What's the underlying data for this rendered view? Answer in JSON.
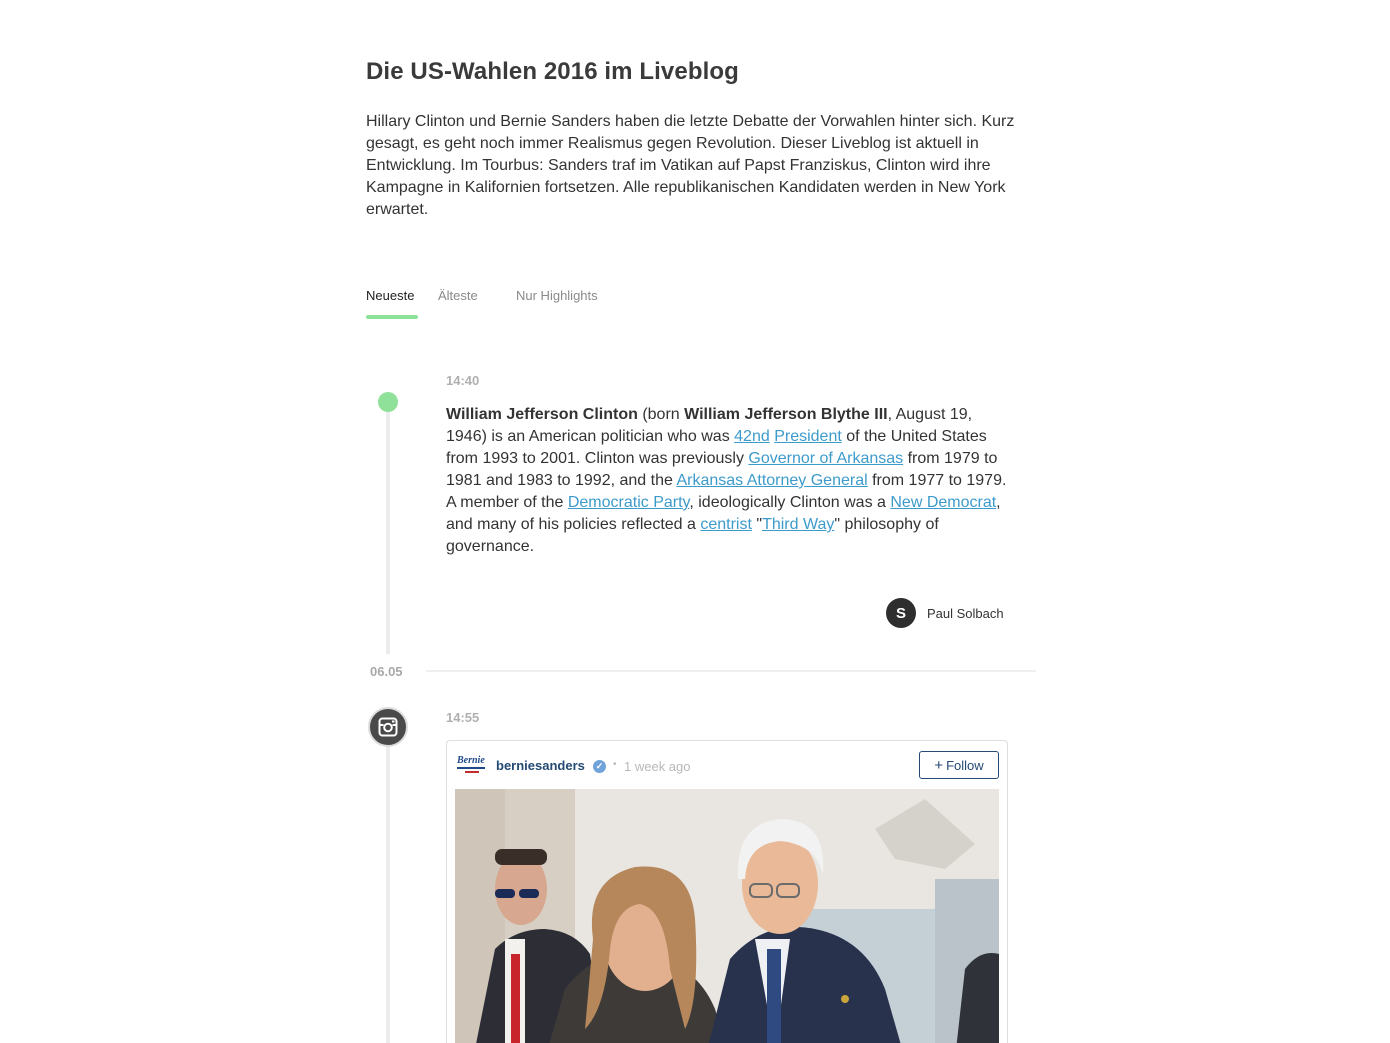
{
  "header": {
    "title": "Die US-Wahlen 2016 im Liveblog",
    "intro": "Hillary Clinton und Bernie Sanders haben die letzte Debatte der Vorwahlen hinter sich. Kurz gesagt, es geht noch immer Realismus gegen Revolution. Dieser Liveblog ist aktuell in Entwicklung. Im Tourbus: Sanders traf im Vatikan auf Papst Franziskus, Clinton wird ihre Kampagne in Kalifornien fortsetzen. Alle republikanischen Kandidaten werden in New York erwartet."
  },
  "tabs": [
    {
      "label": "Neueste",
      "active": true
    },
    {
      "label": "Älteste",
      "active": false
    },
    {
      "label": "Nur Highlights",
      "active": false
    }
  ],
  "posts": [
    {
      "time": "14:40",
      "body": {
        "t1": "William Jefferson Clinton",
        "t2": " (born ",
        "t3": "William Jefferson Blythe III",
        "t4": ", August 19, 1946) is an American politician who was ",
        "l1": "42nd",
        "t5": " ",
        "l2": "President",
        "t6": " of the United States from 1993 to 2001. Clinton was previously ",
        "l3": "Governor of Arkansas",
        "t7": " from 1979 to 1981 and 1983 to 1992, and the ",
        "l4": "Arkansas Attorney General",
        "t8": " from 1977 to 1979. A member of the ",
        "l5": "Democratic Party",
        "t9": ", ideologically Clinton was a ",
        "l6": "New Democrat",
        "t10": ", and many of his policies reflected a ",
        "l7": "centrist",
        "t11": " \"",
        "l8": "Third Way",
        "t12": "\" philosophy of governance."
      },
      "author": {
        "initial": "S",
        "name": "Paul Solbach"
      }
    },
    {
      "date_separator": "06.05",
      "time": "14:55",
      "embed": {
        "source_icon": "instagram-icon",
        "profile_logo_text": "Bernie",
        "username": "berniesanders",
        "separator": "•",
        "posted_ago": "1 week ago",
        "follow_plus": "+",
        "follow_label": "Follow"
      }
    }
  ],
  "colors": {
    "accent_green": "#8fe19a",
    "link_blue": "#3d9bcb",
    "instagram_blue": "#254a74"
  }
}
